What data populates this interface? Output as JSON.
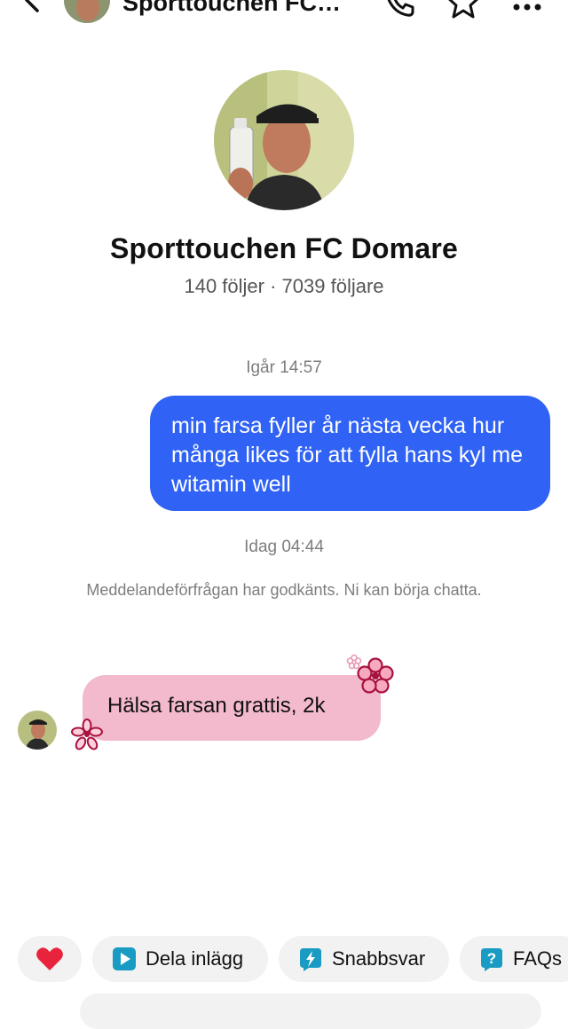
{
  "header": {
    "title": "Sporttouchen FC…"
  },
  "profile": {
    "name": "Sporttouchen FC Domare",
    "stats": "140 följer · 7039 följare"
  },
  "conversation": {
    "timestamp_1": "Igår 14:57",
    "outgoing_message": "min farsa fyller år nästa vecka hur många likes för att fylla hans kyl me witamin well",
    "timestamp_2": "Idag 04:44",
    "notice": "Meddelandeförfrågan har godkänts. Ni kan börja chatta.",
    "incoming_message": "Hälsa farsan grattis, 2k"
  },
  "quick_actions": {
    "share_post": "Dela inlägg",
    "quick_reply": "Snabbsvar",
    "faqs": "FAQs"
  },
  "colors": {
    "outgoing_bubble": "#2f62f5",
    "incoming_bubble": "#f3b9cc",
    "heart": "#e8243c",
    "action_icon": "#1a9bc4"
  }
}
